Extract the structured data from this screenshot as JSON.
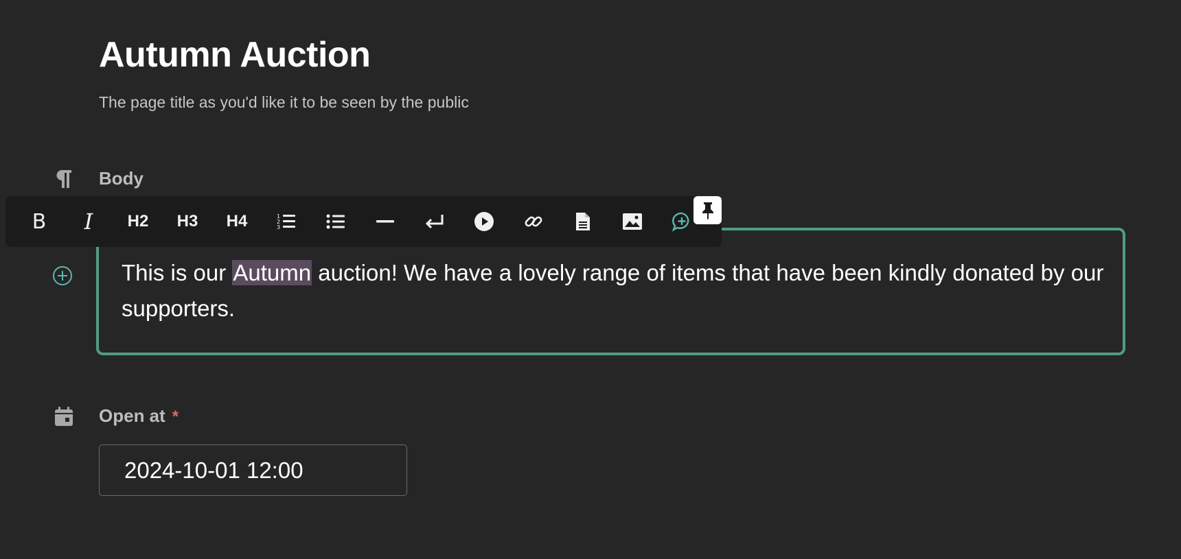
{
  "title": {
    "text": "Autumn Auction",
    "help": "The page title as you'd like it to be seen by the public"
  },
  "body_field": {
    "label": "Body",
    "icon": "pilcrow-icon",
    "text_before": "This is our ",
    "text_selected": "Autumn",
    "text_after": " auction! We have a lovely range of items that have been kindly donated by our supporters."
  },
  "toolbar": {
    "buttons": [
      {
        "name": "bold",
        "label": "B"
      },
      {
        "name": "italic",
        "label": "I"
      },
      {
        "name": "h2",
        "label": "H2"
      },
      {
        "name": "h3",
        "label": "H3"
      },
      {
        "name": "h4",
        "label": "H4"
      },
      {
        "name": "ordered-list",
        "icon": "ordered-list-icon"
      },
      {
        "name": "bullet-list",
        "icon": "bullet-list-icon"
      },
      {
        "name": "horizontal-rule",
        "icon": "horizontal-rule-icon"
      },
      {
        "name": "line-break",
        "icon": "return-icon"
      },
      {
        "name": "embed",
        "icon": "play-icon"
      },
      {
        "name": "link",
        "icon": "link-icon"
      },
      {
        "name": "document",
        "icon": "document-icon"
      },
      {
        "name": "image",
        "icon": "image-icon"
      },
      {
        "name": "comment",
        "icon": "comment-add-icon"
      }
    ],
    "pin_icon": "pin-icon",
    "comment_color": "#5ab8b0"
  },
  "open_at": {
    "label": "Open at",
    "required_marker": "*",
    "value": "2024-10-01 12:00",
    "icon": "calendar-icon"
  },
  "colors": {
    "background": "#262626",
    "focus_border": "#4f9c83",
    "selection": "#5b4b5e",
    "required": "#e06666"
  }
}
